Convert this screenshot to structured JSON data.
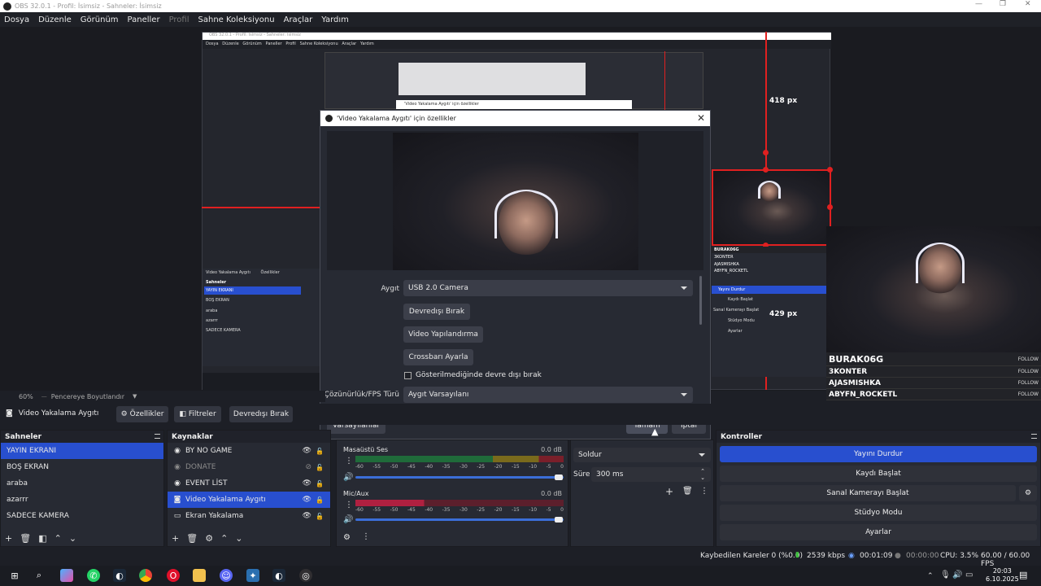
{
  "window": {
    "title": "OBS 32.0.1 - Profil: İsimsiz - Sahneler: İsimsiz",
    "controls": [
      "—",
      "❐",
      "✕"
    ]
  },
  "menu": {
    "items": [
      "Dosya",
      "Düzenle",
      "Görünüm",
      "Paneller",
      "Profil",
      "Sahne Koleksiyonu",
      "Araçlar",
      "Yardım"
    ]
  },
  "preview": {
    "measure_top": "418 px",
    "measure_right": "429 px",
    "zoom": "60%",
    "scaling": "Pencereye Boyutlandır",
    "nested_title": "OBS 32.0.1 - Profil: İsimsiz - Sahneler: İsimsiz",
    "nested_dialog_title": "'Video Yakalama Aygıtı' için özellikler"
  },
  "overlay": {
    "rows": [
      {
        "name": "BURAK06G",
        "action": "FOLLOW"
      },
      {
        "name": "3KONTER",
        "action": "FOLLOW"
      },
      {
        "name": "AJASMISHKA",
        "action": "FOLLOW"
      },
      {
        "name": "ABYFN_ROCKETL",
        "action": "FOLLOW"
      }
    ]
  },
  "dialog": {
    "title": "'Video Yakalama Aygıtı' için özellikler",
    "device_label": "Aygıt",
    "device_value": "USB 2.0 Camera",
    "deactivate_button": "Devredışı Bırak",
    "configure_video_button": "Video Yapılandırma",
    "crossbar_button": "Crossbarı Ayarla",
    "hide_checkbox_label": "Gösterilmediğinde devre dışı bırak",
    "resolution_label": "Çözünürlük/FPS Türü",
    "resolution_value": "Aygıt Varsayılanı",
    "defaults_button": "Varsayılanlar",
    "ok_button": "Tamam",
    "cancel_button": "İptal"
  },
  "source_toolbar": {
    "source_name": "Video Yakalama Aygıtı",
    "properties": "Özellikler",
    "filters": "Filtreler",
    "deactivate": "Devredışı Bırak"
  },
  "scenes": {
    "title": "Sahneler",
    "items": [
      "YAYIN EKRANI",
      "BOŞ EKRAN",
      "araba",
      "azarrr",
      "SADECE KAMERA"
    ]
  },
  "sources": {
    "title": "Kaynaklar",
    "items": [
      "BY NO GAME",
      "DONATE",
      "EVENT LİST",
      "Video Yakalama Aygıtı",
      "Ekran Yakalama"
    ]
  },
  "mixer": {
    "desktop_label": "Masaüstü Ses",
    "desktop_db": "0.0 dB",
    "mic_label": "Mic/Aux",
    "mic_db": "0.0 dB",
    "scale": [
      "-60",
      "-55",
      "-50",
      "-45",
      "-40",
      "-35",
      "-30",
      "-25",
      "-20",
      "-15",
      "-10",
      "-5",
      "0"
    ]
  },
  "transitions": {
    "type": "Soldur",
    "duration_label": "Süre",
    "duration_value": "300 ms"
  },
  "controls": {
    "title": "Kontroller",
    "stop_stream": "Yayını Durdur",
    "start_record": "Kaydı Başlat",
    "virtual_cam": "Sanal Kamerayı Başlat",
    "studio_mode": "Stüdyo Modu",
    "settings": "Ayarlar"
  },
  "status": {
    "dropped": "Kaybedilen Kareler 0 (%0.0)",
    "bitrate": "2539 kbps",
    "stream_time": "00:01:09",
    "record_time": "00:00:00",
    "cpu": "CPU: 3.5%",
    "fps": "60.00 / 60.00 FPS"
  },
  "taskbar": {
    "time": "20:03",
    "date": "6.10.2025"
  },
  "colors": {
    "accent": "#284fcf",
    "guide_red": "#e02020"
  }
}
